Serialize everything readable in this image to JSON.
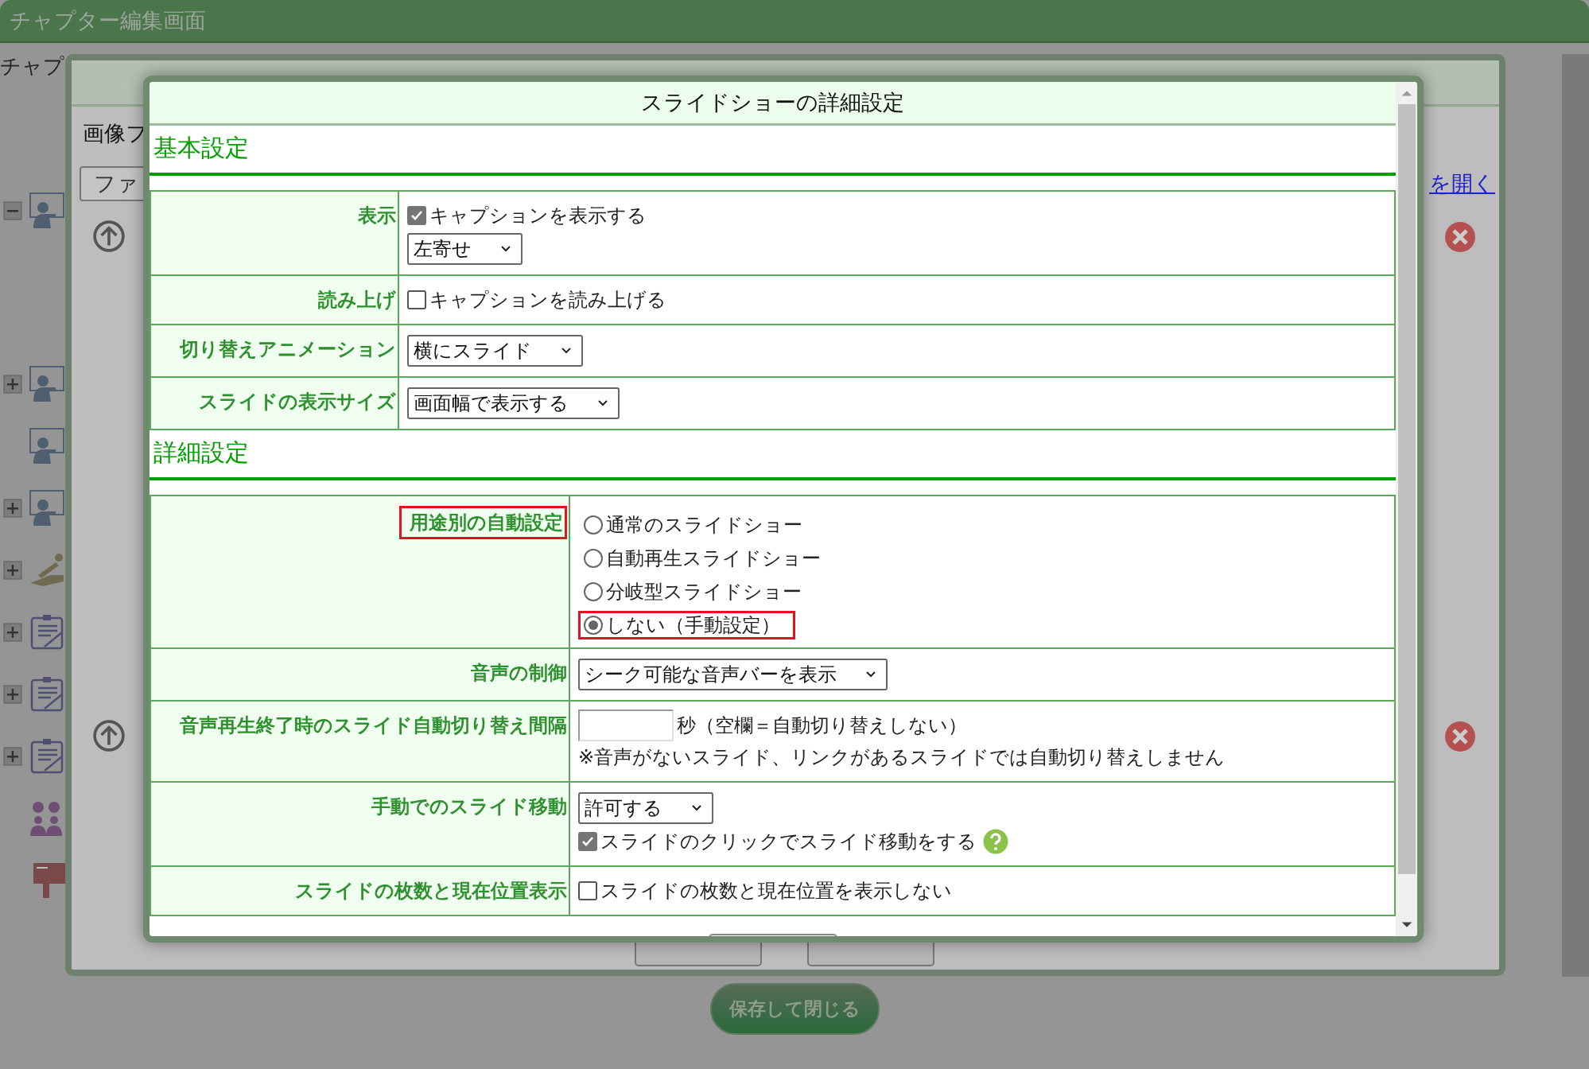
{
  "page": {
    "title": "チャプター編集画面",
    "label": "チャプ"
  },
  "tree_items": [
    {
      "kind": "presenter",
      "expanded": true
    },
    {
      "kind": "presenter",
      "expanded": false
    },
    {
      "kind": "presenter"
    },
    {
      "kind": "presenter",
      "expanded": false
    },
    {
      "kind": "drawing",
      "expanded": false
    },
    {
      "kind": "clipboard",
      "expanded": false
    },
    {
      "kind": "clipboard",
      "expanded": false
    },
    {
      "kind": "clipboard",
      "expanded": false
    },
    {
      "kind": "people"
    },
    {
      "kind": "post"
    }
  ],
  "editor": {
    "label": "画像フ",
    "field_value": "ファ",
    "link": "を開く"
  },
  "save_close_button": "保存して閉じる",
  "dialog": {
    "title": "スライドショーの詳細設定",
    "sections": [
      {
        "heading": "基本設定",
        "rows": [
          {
            "label": "表示",
            "controls": [
              {
                "kind": "checkbox",
                "label": "キャプションを表示する",
                "checked": true
              },
              {
                "kind": "select",
                "value": "左寄せ"
              }
            ]
          },
          {
            "label": "読み上げ",
            "controls": [
              {
                "kind": "checkbox",
                "label": "キャプションを読み上げる",
                "checked": false
              }
            ]
          },
          {
            "label": "切り替えアニメーション",
            "controls": [
              {
                "kind": "select",
                "value": "横にスライド"
              }
            ]
          },
          {
            "label": "スライドの表示サイズ",
            "controls": [
              {
                "kind": "select",
                "value": "画面幅で表示する"
              }
            ]
          }
        ]
      },
      {
        "heading": "詳細設定",
        "rows": [
          {
            "label": "用途別の自動設定",
            "highlighted": true,
            "controls": [
              {
                "kind": "radio",
                "options": [
                  {
                    "label": "通常のスライドショー",
                    "selected": false,
                    "highlighted": false
                  },
                  {
                    "label": "自動再生スライドショー",
                    "selected": false,
                    "highlighted": false
                  },
                  {
                    "label": "分岐型スライドショー",
                    "selected": false,
                    "highlighted": false
                  },
                  {
                    "label": "しない（手動設定）",
                    "selected": true,
                    "highlighted": true
                  }
                ]
              }
            ]
          },
          {
            "label": "音声の制御",
            "controls": [
              {
                "kind": "select",
                "value": "シーク可能な音声バーを表示"
              }
            ]
          },
          {
            "label": "音声再生終了時のスライド自動切り替え間隔",
            "controls": [
              {
                "kind": "input",
                "suffix": "秒（空欄＝自動切り替えしない）"
              },
              {
                "kind": "note",
                "text": "※音声がないスライド、リンクがあるスライドでは自動切り替えしません"
              }
            ]
          },
          {
            "label": "手動でのスライド移動",
            "controls": [
              {
                "kind": "select",
                "value": "許可する"
              },
              {
                "kind": "checkbox",
                "label": "スライドのクリックでスライド移動をする",
                "checked": true,
                "help": true
              }
            ]
          },
          {
            "label": "スライドの枚数と現在位置表示",
            "controls": [
              {
                "kind": "checkbox",
                "label": "スライドの枚数と現在位置を表示しない",
                "checked": false
              }
            ]
          }
        ]
      }
    ]
  }
}
